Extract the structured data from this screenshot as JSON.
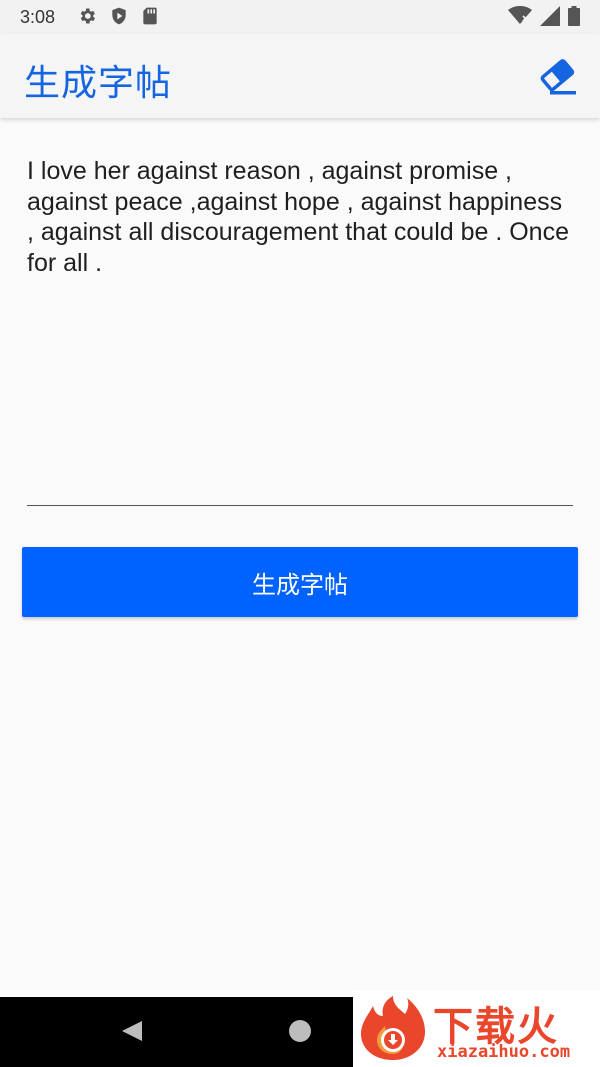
{
  "status_bar": {
    "time": "3:08",
    "left_icons": [
      "settings-icon",
      "shield-icon",
      "sd-card-icon"
    ],
    "right_icons": [
      "wifi-icon",
      "cell-signal-icon",
      "battery-icon"
    ]
  },
  "app_bar": {
    "title": "生成字帖",
    "action_icon": "eraser-icon",
    "accent_color": "#1565e0"
  },
  "editor": {
    "text": "I love her against reason , against promise , against peace ,against hope , against happiness , against all discouragement that could be . Once for all ."
  },
  "generate_button": {
    "label": "生成字帖",
    "color": "#0062ff"
  },
  "nav_bar": {
    "icons": [
      "back-icon",
      "home-icon"
    ]
  },
  "watermark": {
    "text": "下载火",
    "url": "xiazaihuo.com",
    "color": "#e9462b"
  }
}
